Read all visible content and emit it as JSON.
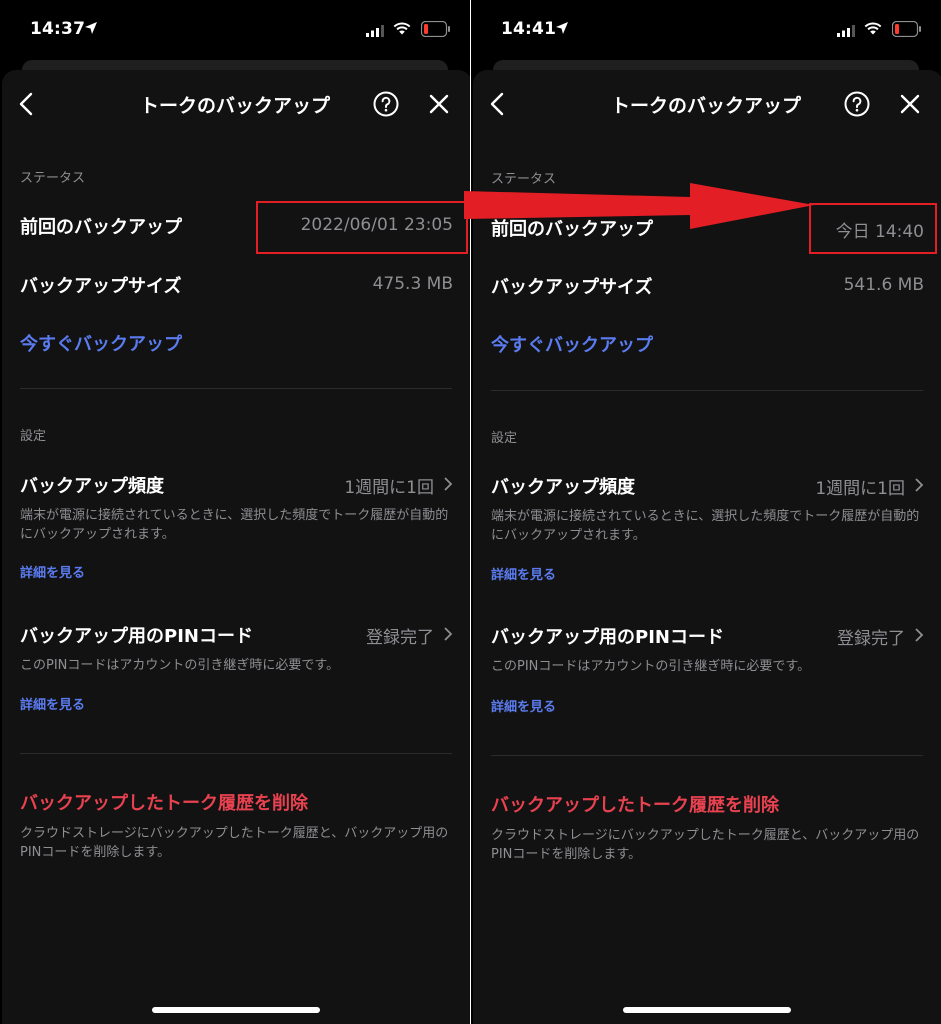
{
  "colors": {
    "background": "#000000",
    "sheet": "#121212",
    "link": "#5b7bf0",
    "danger": "#e8414f",
    "highlight": "#e31f25",
    "secondary_text": "#8e8e93"
  },
  "icons": [
    "location-arrow-icon",
    "cellular-signal-icon",
    "wifi-icon",
    "battery-low-icon",
    "back-chevron-icon",
    "help-icon",
    "close-icon",
    "chevron-right-icon",
    "red-arrow"
  ],
  "screens": [
    {
      "status": {
        "time": "14:37"
      },
      "nav": {
        "title": "トークのバックアップ"
      },
      "status_section": {
        "heading": "ステータス",
        "last_backup_label": "前回のバックアップ",
        "last_backup_value": "2022/06/01 23:05",
        "size_label": "バックアップサイズ",
        "size_value": "475.3 MB",
        "backup_now": "今すぐバックアップ"
      },
      "settings_section": {
        "heading": "設定",
        "frequency_label": "バックアップ頻度",
        "frequency_value": "1週間に1回",
        "frequency_desc": "端末が電源に接続されているときに、選択した頻度でトーク履歴が自動的にバックアップされます。",
        "details_link": "詳細を見る",
        "pin_label": "バックアップ用のPINコード",
        "pin_value": "登録完了",
        "pin_desc": "このPINコードはアカウントの引き継ぎ時に必要です。",
        "pin_details_link": "詳細を見る"
      },
      "delete_section": {
        "title": "バックアップしたトーク履歴を削除",
        "desc": "クラウドストレージにバックアップしたトーク履歴と、バックアップ用のPINコードを削除します。"
      }
    },
    {
      "status": {
        "time": "14:41"
      },
      "nav": {
        "title": "トークのバックアップ"
      },
      "status_section": {
        "heading": "ステータス",
        "last_backup_label": "前回のバックアップ",
        "last_backup_value": "今日 14:40",
        "size_label": "バックアップサイズ",
        "size_value": "541.6 MB",
        "backup_now": "今すぐバックアップ"
      },
      "settings_section": {
        "heading": "設定",
        "frequency_label": "バックアップ頻度",
        "frequency_value": "1週間に1回",
        "frequency_desc": "端末が電源に接続されているときに、選択した頻度でトーク履歴が自動的にバックアップされます。",
        "details_link": "詳細を見る",
        "pin_label": "バックアップ用のPINコード",
        "pin_value": "登録完了",
        "pin_desc": "このPINコードはアカウントの引き継ぎ時に必要です。",
        "pin_details_link": "詳細を見る"
      },
      "delete_section": {
        "title": "バックアップしたトーク履歴を削除",
        "desc": "クラウドストレージにバックアップしたトーク履歴と、バックアップ用のPINコードを削除します。"
      }
    }
  ]
}
